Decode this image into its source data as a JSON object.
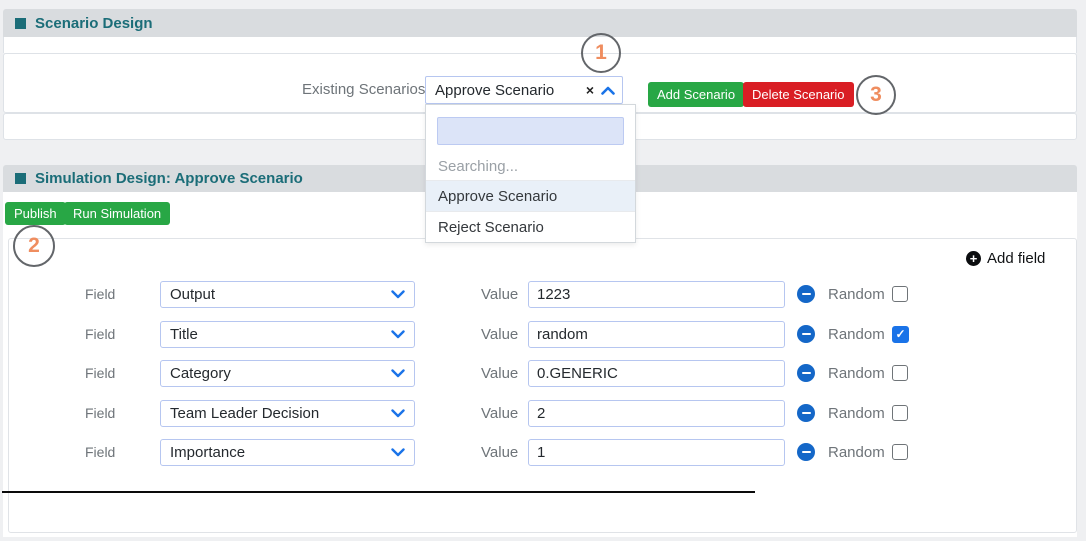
{
  "scenario_design": {
    "title": "Scenario Design",
    "existing_label": "Existing Scenarios",
    "select_value": "Approve Scenario",
    "add_button": "Add Scenario",
    "delete_button": "Delete Scenario"
  },
  "dropdown": {
    "search_value": "",
    "searching_text": "Searching...",
    "options": [
      {
        "label": "Approve Scenario",
        "highlighted": true
      },
      {
        "label": "Reject Scenario",
        "highlighted": false
      }
    ]
  },
  "simulation_design": {
    "title": "Simulation Design: Approve Scenario",
    "publish_button": "Publish",
    "run_button": "Run Simulation",
    "add_field_label": "Add field"
  },
  "field_rows": {
    "field_label": "Field",
    "value_label": "Value",
    "random_label": "Random",
    "rows": [
      {
        "field": "Output",
        "value": "1223",
        "random": false
      },
      {
        "field": "Title",
        "value": "random",
        "random": true
      },
      {
        "field": "Category",
        "value": "0.GENERIC",
        "random": false
      },
      {
        "field": "Team Leader Decision",
        "value": "2",
        "random": false
      },
      {
        "field": "Importance",
        "value": "1",
        "random": false
      }
    ]
  },
  "annotations": {
    "step1": "1",
    "step2": "2",
    "step3": "3"
  },
  "colors": {
    "green": "#28a745",
    "red": "#d91e24",
    "teal": "#1b6d78",
    "blue": "#1a73e8",
    "minus_blue": "#1467c8",
    "orange": "#ef8d5f",
    "bar_gray": "#d9dcdf",
    "page_gray": "#eff0f2",
    "input_border": "#b6c6f0"
  }
}
